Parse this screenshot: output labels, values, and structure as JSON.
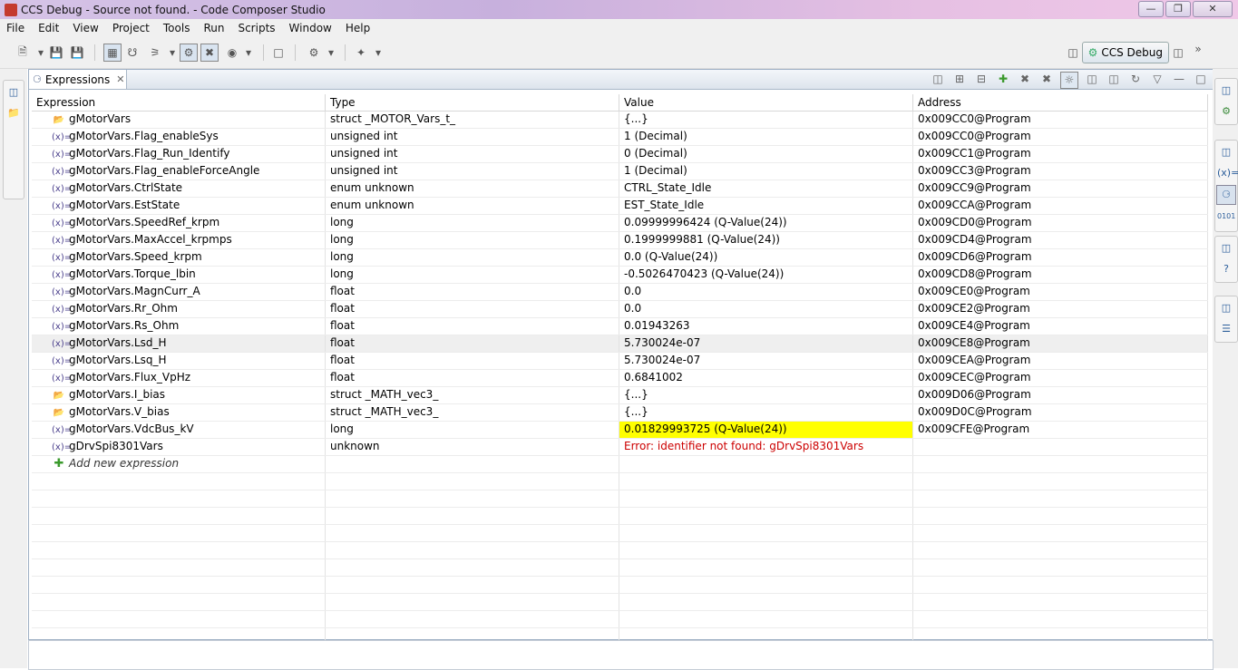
{
  "window": {
    "title": "CCS Debug - Source not found. - Code Composer Studio"
  },
  "menu": [
    "File",
    "Edit",
    "View",
    "Project",
    "Tools",
    "Run",
    "Scripts",
    "Window",
    "Help"
  ],
  "perspective": {
    "label": "CCS Debug"
  },
  "view": {
    "tab_label": "Expressions"
  },
  "columns": [
    "Expression",
    "Type",
    "Value",
    "Address"
  ],
  "rows": [
    {
      "expr": "gMotorVars",
      "type": "struct _MOTOR_Vars_t_",
      "value": "{...}",
      "address": "0x009CC0@Program",
      "icon": "struct"
    },
    {
      "expr": "gMotorVars.Flag_enableSys",
      "type": "unsigned int",
      "value": "1 (Decimal)",
      "address": "0x009CC0@Program",
      "icon": "var"
    },
    {
      "expr": "gMotorVars.Flag_Run_Identify",
      "type": "unsigned int",
      "value": "0 (Decimal)",
      "address": "0x009CC1@Program",
      "icon": "var"
    },
    {
      "expr": "gMotorVars.Flag_enableForceAngle",
      "type": "unsigned int",
      "value": "1 (Decimal)",
      "address": "0x009CC3@Program",
      "icon": "var"
    },
    {
      "expr": "gMotorVars.CtrlState",
      "type": "enum unknown",
      "value": "CTRL_State_Idle",
      "address": "0x009CC9@Program",
      "icon": "var"
    },
    {
      "expr": "gMotorVars.EstState",
      "type": "enum unknown",
      "value": "EST_State_Idle",
      "address": "0x009CCA@Program",
      "icon": "var"
    },
    {
      "expr": "gMotorVars.SpeedRef_krpm",
      "type": "long",
      "value": "0.09999996424 (Q-Value(24))",
      "address": "0x009CD0@Program",
      "icon": "var"
    },
    {
      "expr": "gMotorVars.MaxAccel_krpmps",
      "type": "long",
      "value": "0.1999999881 (Q-Value(24))",
      "address": "0x009CD4@Program",
      "icon": "var"
    },
    {
      "expr": "gMotorVars.Speed_krpm",
      "type": "long",
      "value": "0.0 (Q-Value(24))",
      "address": "0x009CD6@Program",
      "icon": "var"
    },
    {
      "expr": "gMotorVars.Torque_lbin",
      "type": "long",
      "value": "-0.5026470423 (Q-Value(24))",
      "address": "0x009CD8@Program",
      "icon": "var"
    },
    {
      "expr": "gMotorVars.MagnCurr_A",
      "type": "float",
      "value": "0.0",
      "address": "0x009CE0@Program",
      "icon": "var"
    },
    {
      "expr": "gMotorVars.Rr_Ohm",
      "type": "float",
      "value": "0.0",
      "address": "0x009CE2@Program",
      "icon": "var"
    },
    {
      "expr": "gMotorVars.Rs_Ohm",
      "type": "float",
      "value": "0.01943263",
      "address": "0x009CE4@Program",
      "icon": "var"
    },
    {
      "expr": "gMotorVars.Lsd_H",
      "type": "float",
      "value": "5.730024e-07",
      "address": "0x009CE8@Program",
      "icon": "var",
      "selected": true
    },
    {
      "expr": "gMotorVars.Lsq_H",
      "type": "float",
      "value": "5.730024e-07",
      "address": "0x009CEA@Program",
      "icon": "var"
    },
    {
      "expr": "gMotorVars.Flux_VpHz",
      "type": "float",
      "value": "0.6841002",
      "address": "0x009CEC@Program",
      "icon": "var"
    },
    {
      "expr": "gMotorVars.I_bias",
      "type": "struct _MATH_vec3_",
      "value": "{...}",
      "address": "0x009D06@Program",
      "icon": "struct"
    },
    {
      "expr": "gMotorVars.V_bias",
      "type": "struct _MATH_vec3_",
      "value": "{...}",
      "address": "0x009D0C@Program",
      "icon": "struct"
    },
    {
      "expr": "gMotorVars.VdcBus_kV",
      "type": "long",
      "value": "0.01829993725 (Q-Value(24))",
      "address": "0x009CFE@Program",
      "icon": "var",
      "highlight": true
    },
    {
      "expr": "gDrvSpi8301Vars",
      "type": "unknown",
      "value": "Error: identifier not found: gDrvSpi8301Vars",
      "address": "",
      "icon": "var",
      "error": true
    }
  ],
  "add_expression": "Add new expression",
  "colors": {
    "highlight": "#ffff00",
    "error": "#cc0000",
    "title_gradient_start": "#d6c4e7"
  }
}
